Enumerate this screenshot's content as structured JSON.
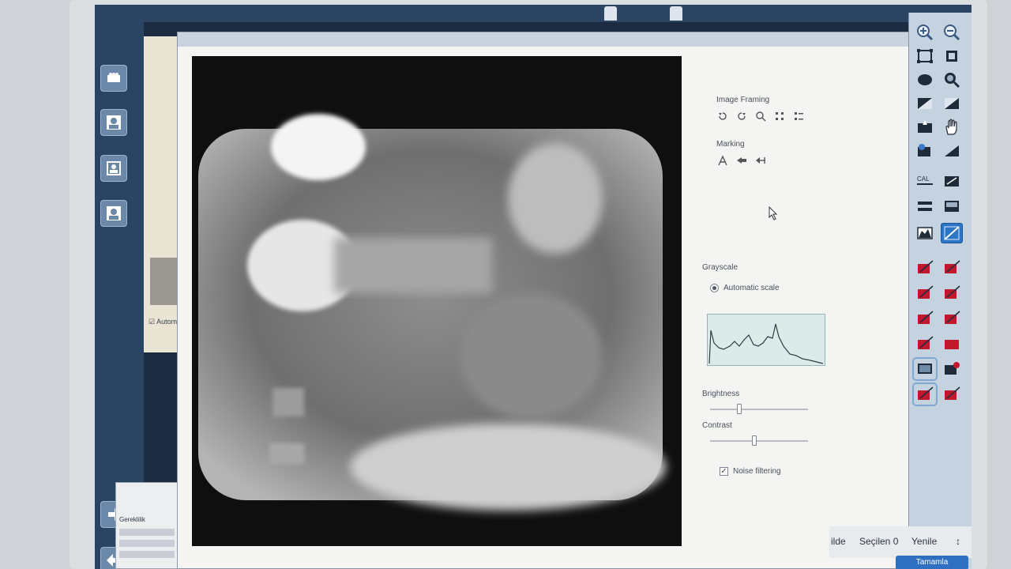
{
  "window": {
    "app_title": "",
    "top_tabs": [
      "",
      ""
    ]
  },
  "dialog": {
    "tab_label": ""
  },
  "controls": {
    "image_framing_label": "Image Framing",
    "marking_label": "Marking",
    "grayscale_label": "Grayscale",
    "automatic_scale_label": "Automatic scale",
    "brightness_label": "Brightness",
    "contrast_label": "Contrast",
    "noise_filtering_label": "Noise filtering",
    "automatic_scale_selected": true,
    "noise_filtering_checked": true,
    "brightness_level": 0.3,
    "contrast_level": 0.45
  },
  "background_panel": {
    "checkbox_label": "Automatic",
    "lower_label": "Gereklilik"
  },
  "bottom_bar": {
    "item1": "ilde",
    "item2": "Seçilen 0",
    "item3": "Yenile",
    "item4": "↕",
    "blue_button": "Tamamla"
  },
  "toolbar": {
    "cal_label": "CAL"
  },
  "icons": {
    "zoom_in": "zoom-in-icon",
    "zoom_out": "zoom-out-icon",
    "hand": "hand-pan-icon"
  },
  "colors": {
    "screen_bg": "#1d2b40",
    "toolbar_bg": "#c5d2e0",
    "active_tool": "#2c76c7",
    "measure_red": "#c0192e",
    "histogram_bg": "#dcebea"
  }
}
